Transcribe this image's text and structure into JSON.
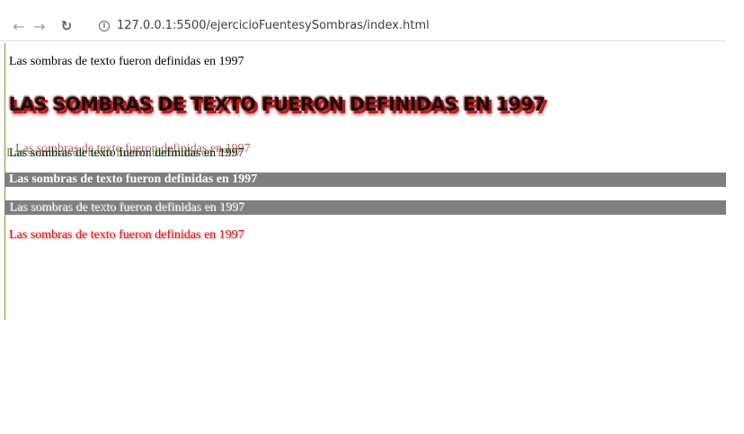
{
  "browser": {
    "back_icon": "arrow-left-icon",
    "forward_icon": "arrow-right-icon",
    "reload_icon": "reload-icon",
    "info_icon": "info-icon",
    "url_host": "127.0.0.1",
    "url_path": ":5500/ejercicioFuentesySombras/index.html"
  },
  "content": {
    "line1": "Las sombras de texto fueron definidas en 1997",
    "line2": "Las sombras de texto fueron definidas en 1997",
    "line3": "Las sombras de texto fueron definidas en 1997",
    "line4": "Las sombras de texto fueron definidas en 1997",
    "line5": "Las sombras de texto fueron definidas en 1997",
    "line6": "Las sombras de texto fueron definidas en 1997"
  },
  "colors": {
    "band": "#7f7f7f",
    "shadow_red": "#c81414",
    "shadow_green": "#6b9b3a",
    "text_red": "#e01010"
  }
}
